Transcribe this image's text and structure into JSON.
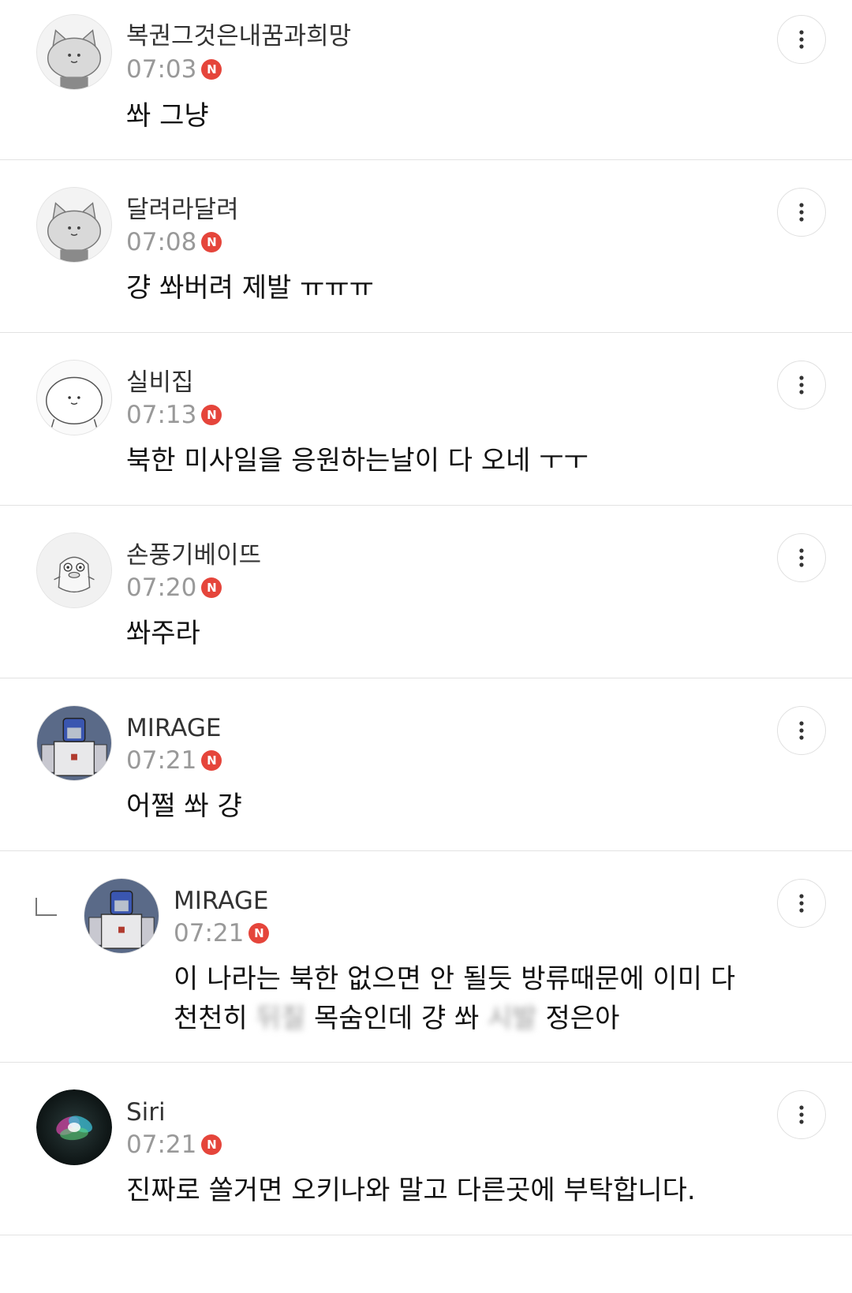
{
  "comments": [
    {
      "author": "복권그것은내꿈과희망",
      "time": "07:03",
      "badge": "N",
      "text": "쏴 그냥",
      "avatar": "cat-face-avatar"
    },
    {
      "author": "달려라달려",
      "time": "07:08",
      "badge": "N",
      "text": "걍 쏴버려 제발 ㅠㅠㅠ",
      "avatar": "cat-face-avatar"
    },
    {
      "author": "실비집",
      "time": "07:13",
      "badge": "N",
      "text": "북한 미사일을 응원하는날이 다 오네 ㅜㅜ",
      "avatar": "round-face-avatar"
    },
    {
      "author": "손풍기베이뜨",
      "time": "07:20",
      "badge": "N",
      "text": "쏴주라",
      "avatar": "bird-avatar"
    },
    {
      "author": "MIRAGE",
      "time": "07:21",
      "badge": "N",
      "text": "어쩔 쏴 걍",
      "avatar": "robot-avatar"
    },
    {
      "author": "MIRAGE",
      "time": "07:21",
      "badge": "N",
      "text_line1": "이 나라는 북한 없으면 안 될듯 방류때문에 이미 다",
      "text_line2_a": "천천히 ",
      "text_line2_blur1": "뒤질",
      "text_line2_b": " 목숨인데 걍 쏴 ",
      "text_line2_blur2": "시발",
      "text_line2_c": " 정은아",
      "avatar": "robot-avatar",
      "is_reply": true
    },
    {
      "author": "Siri",
      "time": "07:21",
      "badge": "N",
      "text": "진짜로 쏠거면 오키나와 말고 다른곳에 부탁합니다.",
      "avatar": "siri-orb-avatar"
    }
  ],
  "icons": {
    "more": "more-vertical-icon",
    "reply": "reply-arrow-icon"
  },
  "colors": {
    "badge": "#e5453b",
    "time": "#999999",
    "divider": "#e2e2e2"
  }
}
